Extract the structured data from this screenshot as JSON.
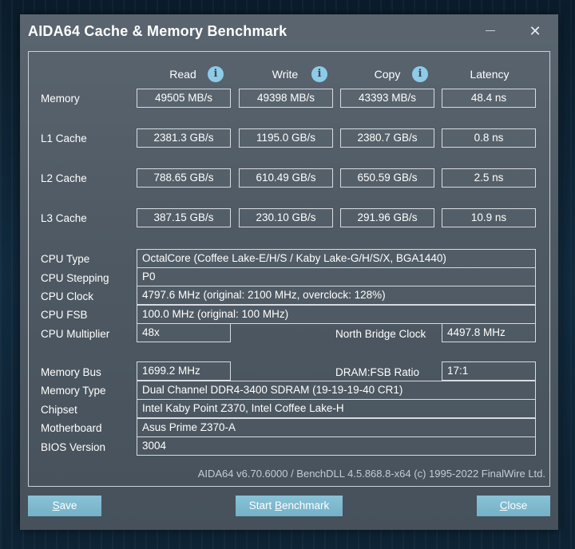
{
  "window": {
    "title": "AIDA64 Cache & Memory Benchmark",
    "minimize_glyph": "—",
    "close_glyph": "✕"
  },
  "columns": {
    "read": "Read",
    "write": "Write",
    "copy": "Copy",
    "latency": "Latency",
    "info_glyph": "i"
  },
  "bench_rows": [
    {
      "label": "Memory",
      "read": "49505 MB/s",
      "write": "49398 MB/s",
      "copy": "43393 MB/s",
      "latency": "48.4 ns"
    },
    {
      "label": "L1 Cache",
      "read": "2381.3 GB/s",
      "write": "1195.0 GB/s",
      "copy": "2380.7 GB/s",
      "latency": "0.8 ns"
    },
    {
      "label": "L2 Cache",
      "read": "788.65 GB/s",
      "write": "610.49 GB/s",
      "copy": "650.59 GB/s",
      "latency": "2.5 ns"
    },
    {
      "label": "L3 Cache",
      "read": "387.15 GB/s",
      "write": "230.10 GB/s",
      "copy": "291.96 GB/s",
      "latency": "10.9 ns"
    }
  ],
  "cpu": {
    "type_label": "CPU Type",
    "type_value": "OctalCore   (Coffee Lake-E/H/S / Kaby Lake-G/H/S/X, BGA1440)",
    "stepping_label": "CPU Stepping",
    "stepping_value": "P0",
    "clock_label": "CPU Clock",
    "clock_value": "4797.6 MHz  (original: 2100 MHz, overclock: 128%)",
    "fsb_label": "CPU FSB",
    "fsb_value": "100.0 MHz  (original: 100 MHz)",
    "multiplier_label": "CPU Multiplier",
    "multiplier_value": "48x",
    "nb_clock_label": "North Bridge Clock",
    "nb_clock_value": "4497.8 MHz"
  },
  "memory": {
    "bus_label": "Memory Bus",
    "bus_value": "1699.2 MHz",
    "ratio_label": "DRAM:FSB Ratio",
    "ratio_value": "17:1",
    "type_label": "Memory Type",
    "type_value": "Dual Channel DDR4-3400 SDRAM  (19-19-19-40 CR1)",
    "chipset_label": "Chipset",
    "chipset_value": "Intel Kaby Point Z370, Intel Coffee Lake-H",
    "motherboard_label": "Motherboard",
    "motherboard_value": "Asus Prime Z370-A",
    "bios_label": "BIOS Version",
    "bios_value": "3004"
  },
  "footer": {
    "credit": "AIDA64 v6.70.6000 / BenchDLL 4.5.868.8-x64  (c) 1995-2022 FinalWire Ltd."
  },
  "buttons": {
    "save_hotkey": "S",
    "save_rest": "ave",
    "start_prefix": "Start ",
    "start_hotkey": "B",
    "start_rest": "enchmark",
    "close_hotkey": "C",
    "close_rest": "lose"
  },
  "colors": {
    "window_bg": "#525d68",
    "button_bg": "#7db8cd",
    "info_icon": "#8ecbe8"
  }
}
